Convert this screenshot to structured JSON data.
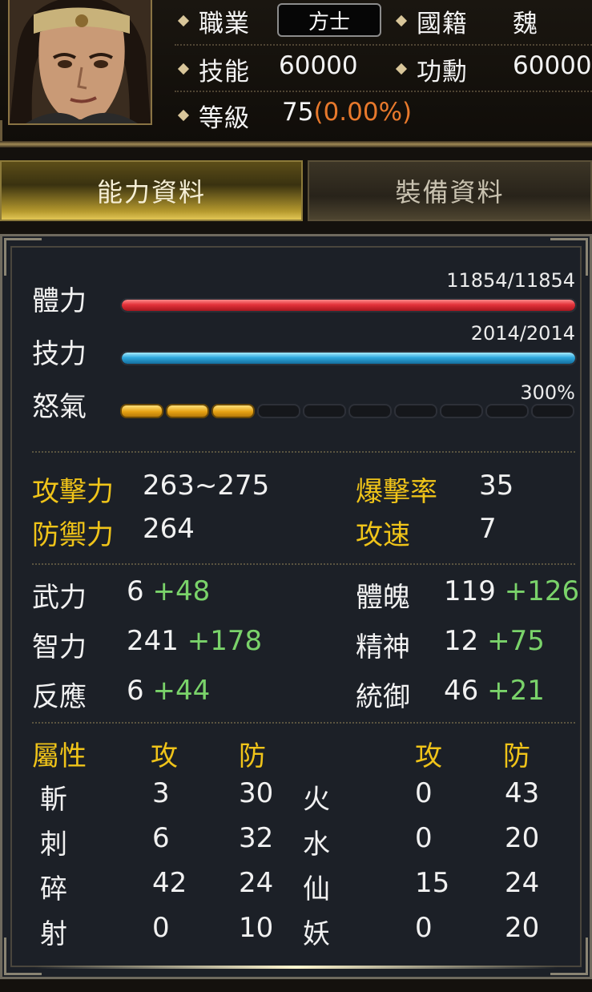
{
  "header": {
    "job_label": "職業",
    "job_value": "方士",
    "nation_label": "國籍",
    "nation_value": "魏",
    "skill_label": "技能",
    "skill_value": "60000",
    "merit_label": "功勳",
    "merit_value": "60000",
    "level_label": "等級",
    "level_value": "75",
    "level_pct": "(0.00%)"
  },
  "tabs": [
    {
      "label": "能力資料",
      "active": true
    },
    {
      "label": "裝備資料",
      "active": false
    }
  ],
  "bars": {
    "hp": {
      "label": "體力",
      "value": "11854/11854",
      "fill": 1.0
    },
    "mp": {
      "label": "技力",
      "value": "2014/2014",
      "fill": 1.0
    },
    "rage": {
      "label": "怒氣",
      "value": "300%",
      "segments_total": 10,
      "segments_on": 3
    }
  },
  "combat": {
    "attack_label": "攻擊力",
    "attack_value": "263~275",
    "crit_label": "爆擊率",
    "crit_value": "35",
    "defense_label": "防禦力",
    "defense_value": "264",
    "speed_label": "攻速",
    "speed_value": "7"
  },
  "attributes": [
    {
      "label": "武力",
      "base": "6",
      "bonus": "+48"
    },
    {
      "label": "體魄",
      "base": "119",
      "bonus": "+126"
    },
    {
      "label": "智力",
      "base": "241",
      "bonus": "+178"
    },
    {
      "label": "精神",
      "base": "12",
      "bonus": "+75"
    },
    {
      "label": "反應",
      "base": "6",
      "bonus": "+44"
    },
    {
      "label": "統御",
      "base": "46",
      "bonus": "+21"
    }
  ],
  "elements": {
    "header": {
      "title": "屬性",
      "atk": "攻",
      "def": "防",
      "atk2": "攻",
      "def2": "防"
    },
    "rows": [
      {
        "a": "斬",
        "a_atk": "3",
        "a_def": "30",
        "b": "火",
        "b_atk": "0",
        "b_def": "43"
      },
      {
        "a": "刺",
        "a_atk": "6",
        "a_def": "32",
        "b": "水",
        "b_atk": "0",
        "b_def": "20"
      },
      {
        "a": "碎",
        "a_atk": "42",
        "a_def": "24",
        "b": "仙",
        "b_atk": "15",
        "b_def": "24"
      },
      {
        "a": "射",
        "a_atk": "0",
        "a_def": "10",
        "b": "妖",
        "b_atk": "0",
        "b_def": "20"
      }
    ]
  },
  "colors": {
    "gold": "#f0c419",
    "green": "#7ad36a",
    "orange": "#e8792c",
    "hp": "#e3323a",
    "mp": "#2fa8dd"
  }
}
